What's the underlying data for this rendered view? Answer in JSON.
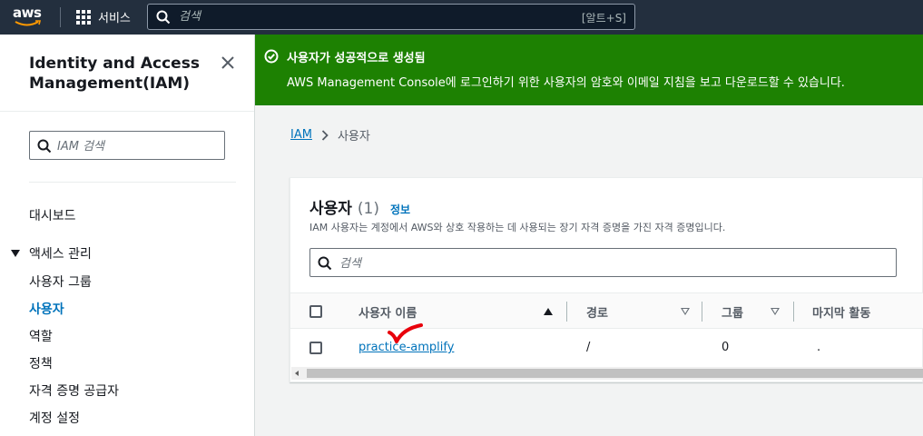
{
  "topbar": {
    "logo_text": "aws",
    "services_label": "서비스",
    "search_placeholder": "검색",
    "search_shortcut": "[알트+S]"
  },
  "sidebar": {
    "title": "Identity and Access Management(IAM)",
    "search_placeholder": "IAM 검색",
    "dashboard": "대시보드",
    "section_access": "액세스 관리",
    "items": [
      {
        "label": "사용자 그룹",
        "active": false
      },
      {
        "label": "사용자",
        "active": true
      },
      {
        "label": "역할",
        "active": false
      },
      {
        "label": "정책",
        "active": false
      },
      {
        "label": "자격 증명 공급자",
        "active": false
      },
      {
        "label": "계정 설정",
        "active": false
      }
    ]
  },
  "flash": {
    "heading": "사용자가 성공적으로 생성됨",
    "message": "AWS Management Console에 로그인하기 위한 사용자의 암호와 이메일 지침을 보고 다운로드할 수 있습니다.",
    "color": "#1d8102"
  },
  "breadcrumb": {
    "root": "IAM",
    "current": "사용자"
  },
  "users_panel": {
    "title": "사용자",
    "count": "(1)",
    "info_link": "정보",
    "description": "IAM 사용자는 계정에서 AWS와 상호 작용하는 데 사용되는 장기 자격 증명을 가진 자격 증명입니다.",
    "search_placeholder": "검색",
    "columns": [
      "사용자 이름",
      "경로",
      "그룹",
      "마지막 활동"
    ],
    "rows": [
      {
        "user_name": "practice-amplify",
        "path": "/",
        "groups": "0",
        "last_activity": "."
      }
    ]
  },
  "colors": {
    "topbar": "#232f3e",
    "link": "#0073bb",
    "annotation": "#e8000b"
  }
}
